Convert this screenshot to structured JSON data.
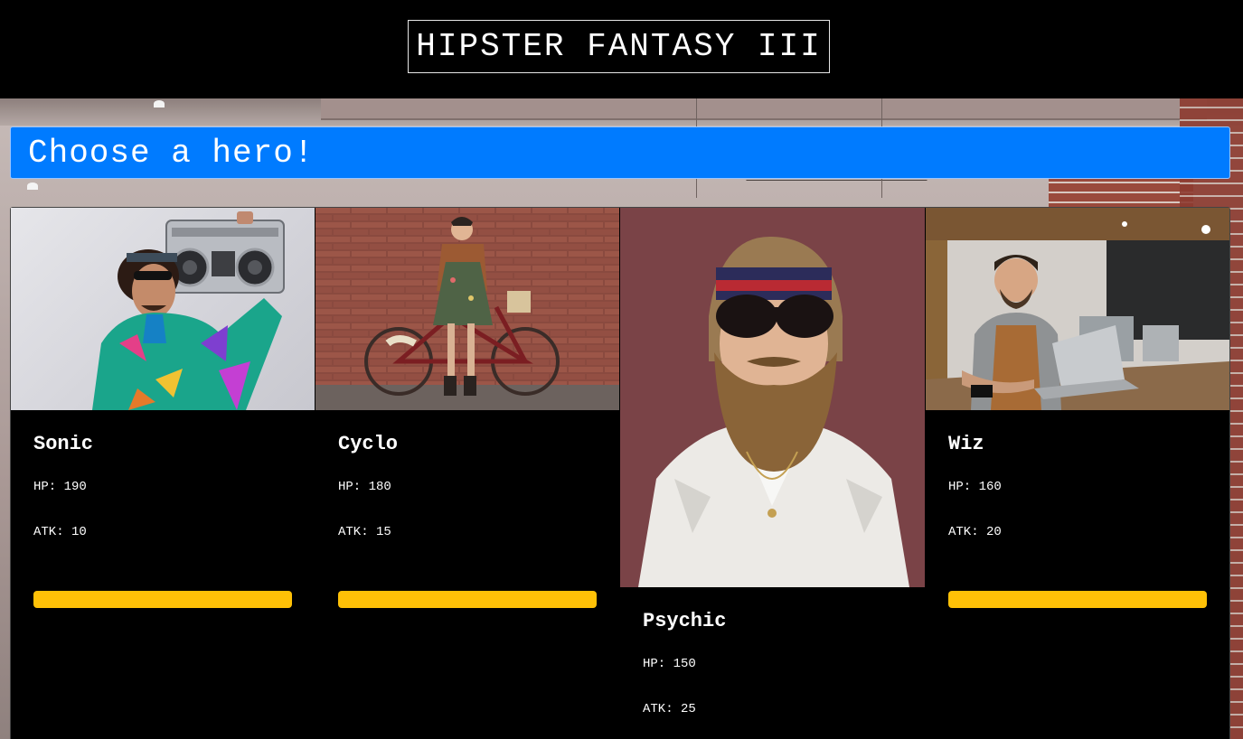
{
  "header": {
    "title": "HIPSTER FANTASY III"
  },
  "banner": {
    "text": "Choose a hero!"
  },
  "heroes": [
    {
      "name": "Sonic",
      "hp": "HP: 190",
      "atk": "ATK: 10",
      "image": "sonic-hero-photo"
    },
    {
      "name": "Cyclo",
      "hp": "HP: 180",
      "atk": "ATK: 15",
      "image": "cyclo-hero-photo"
    },
    {
      "name": "Psychic",
      "hp": "HP: 150",
      "atk": "ATK: 25",
      "image": "psychic-hero-photo"
    },
    {
      "name": "Wiz",
      "hp": "HP: 160",
      "atk": "ATK: 20",
      "image": "wiz-hero-photo"
    }
  ],
  "colors": {
    "header_bg": "#000000",
    "banner_bg": "#007bff",
    "select_button": "#ffc107",
    "card_bg": "#000000",
    "text": "#ffffff"
  }
}
